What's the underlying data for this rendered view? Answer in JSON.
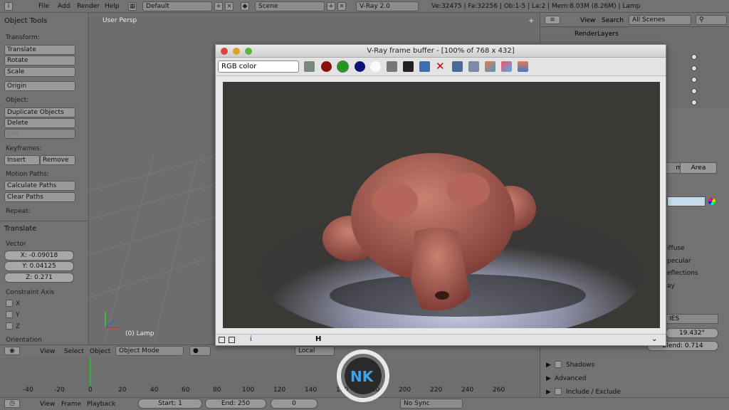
{
  "menu": {
    "file": "File",
    "add": "Add",
    "render": "Render",
    "help": "Help"
  },
  "header": {
    "layout": "Default",
    "scene": "Scene",
    "engine": "V-Ray 2.0",
    "stats": "Ve:32475 | Fa:32256 | Ob:1-5 | La:2 | Mem:8.03M (8.26M) | Lamp"
  },
  "tools": {
    "title": "Object Tools",
    "transform": "Transform:",
    "translate": "Translate",
    "rotate": "Rotate",
    "scale": "Scale",
    "origin": "Origin",
    "object": "Object:",
    "duplicate": "Duplicate Objects",
    "delete": "Delete",
    "join": "Join",
    "keyframes": "Keyframes:",
    "insert": "Insert",
    "remove": "Remove",
    "motion_paths": "Motion Paths:",
    "calc_paths": "Calculate Paths",
    "clear_paths": "Clear Paths",
    "repeat": "Repeat:"
  },
  "operator": {
    "title": "Translate",
    "vector": "Vector",
    "x": "X: -0.09018",
    "y": "Y: 0.04125",
    "z": "Z: 0.271",
    "constraint": "Constraint Axis",
    "cx": "X",
    "cy": "Y",
    "cz": "Z",
    "orientation": "Orientation"
  },
  "viewport": {
    "label": "User Persp",
    "object_label": "(0) Lamp"
  },
  "vray": {
    "title": "V-Ray frame buffer - [100% of 768 x 432]",
    "channel": "RGB color"
  },
  "view_header": {
    "view": "View",
    "select": "Select",
    "object": "Object",
    "mode": "Object Mode",
    "orientation": "Local"
  },
  "timeline": {
    "ticks": [
      "-40",
      "-20",
      "0",
      "20",
      "40",
      "60",
      "80",
      "100",
      "120",
      "140",
      "160",
      "180",
      "200",
      "220",
      "240",
      "260"
    ]
  },
  "bottom": {
    "view": "View",
    "frame": "Frame",
    "playback": "Playback",
    "start": "Start: 1",
    "end": "End: 250",
    "current": "0",
    "sync": "No Sync"
  },
  "outliner": {
    "view": "View",
    "search": "Search",
    "scenes": "All Scenes",
    "render_layers": "RenderLayers"
  },
  "props": {
    "tab_area": "Area",
    "tab_mi": "mi",
    "diffuse": "iffuse",
    "specular": "pecular",
    "reflections": "eflections",
    "ay": "ay",
    "ies": "IES",
    "value1": "19.432°",
    "blend": "Blend: 0.714",
    "shadows": "Shadows",
    "advanced": "Advanced",
    "include": "Include / Exclude"
  },
  "colors": {
    "ui": "#727272",
    "accent_green": "#2bb52b",
    "selection": "#d4e4f0"
  }
}
